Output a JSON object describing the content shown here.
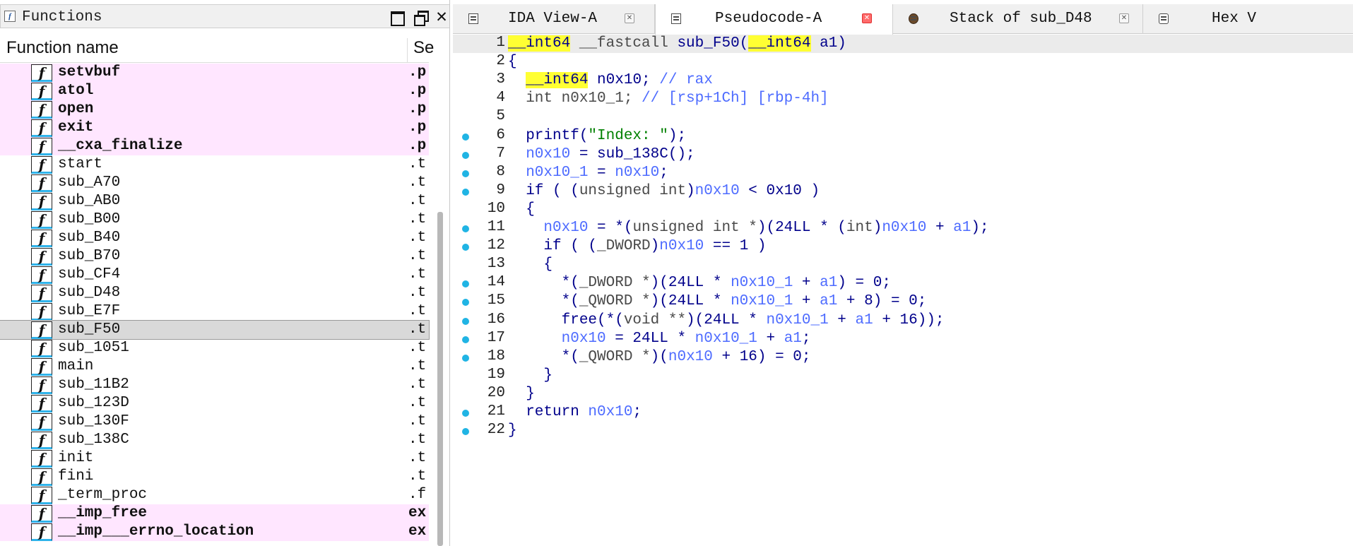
{
  "functions_panel": {
    "title": "Functions",
    "columns": {
      "name": "Function name",
      "segment": "Se"
    },
    "rows": [
      {
        "name": "setvbuf",
        "seg": ".p",
        "kind": "import"
      },
      {
        "name": "atol",
        "seg": ".p",
        "kind": "import"
      },
      {
        "name": "open",
        "seg": ".p",
        "kind": "import"
      },
      {
        "name": "exit",
        "seg": ".p",
        "kind": "import"
      },
      {
        "name": "__cxa_finalize",
        "seg": ".p",
        "kind": "import"
      },
      {
        "name": "start",
        "seg": ".t",
        "kind": "normal"
      },
      {
        "name": "sub_A70",
        "seg": ".t",
        "kind": "normal"
      },
      {
        "name": "sub_AB0",
        "seg": ".t",
        "kind": "normal"
      },
      {
        "name": "sub_B00",
        "seg": ".t",
        "kind": "normal"
      },
      {
        "name": "sub_B40",
        "seg": ".t",
        "kind": "normal"
      },
      {
        "name": "sub_B70",
        "seg": ".t",
        "kind": "normal"
      },
      {
        "name": "sub_CF4",
        "seg": ".t",
        "kind": "normal"
      },
      {
        "name": "sub_D48",
        "seg": ".t",
        "kind": "normal"
      },
      {
        "name": "sub_E7F",
        "seg": ".t",
        "kind": "normal"
      },
      {
        "name": "sub_F50",
        "seg": ".t",
        "kind": "selected"
      },
      {
        "name": "sub_1051",
        "seg": ".t",
        "kind": "normal"
      },
      {
        "name": "main",
        "seg": ".t",
        "kind": "normal"
      },
      {
        "name": "sub_11B2",
        "seg": ".t",
        "kind": "normal"
      },
      {
        "name": "sub_123D",
        "seg": ".t",
        "kind": "normal"
      },
      {
        "name": "sub_130F",
        "seg": ".t",
        "kind": "normal"
      },
      {
        "name": "sub_138C",
        "seg": ".t",
        "kind": "normal"
      },
      {
        "name": "init",
        "seg": ".t",
        "kind": "normal"
      },
      {
        "name": "fini",
        "seg": ".t",
        "kind": "normal"
      },
      {
        "name": "_term_proc",
        "seg": ".f",
        "kind": "normal"
      },
      {
        "name": "__imp_free",
        "seg": "ex",
        "kind": "import"
      },
      {
        "name": "__imp___errno_location",
        "seg": "ex",
        "kind": "import"
      }
    ]
  },
  "tabs": [
    {
      "label": "IDA View-A",
      "active": false
    },
    {
      "label": "Pseudocode-A",
      "active": true
    },
    {
      "label": "Stack of sub_D48",
      "active": false
    },
    {
      "label": "Hex V",
      "active": false
    }
  ],
  "code": {
    "lines": [
      {
        "no": "1",
        "bp": false,
        "hl": true,
        "tokens": [
          [
            "y",
            "__int64"
          ],
          [
            "t",
            " __fastcall "
          ],
          [
            "k",
            "sub_F50("
          ],
          [
            "y",
            "__int64"
          ],
          [
            "k",
            " a1)"
          ]
        ]
      },
      {
        "no": "2",
        "bp": false,
        "hl": false,
        "tokens": [
          [
            "k",
            "{"
          ]
        ]
      },
      {
        "no": "3",
        "bp": false,
        "hl": false,
        "tokens": [
          [
            "k",
            "  "
          ],
          [
            "y",
            "__int64"
          ],
          [
            "k",
            " n0x10; "
          ],
          [
            "c",
            "// rax"
          ]
        ]
      },
      {
        "no": "4",
        "bp": false,
        "hl": false,
        "tokens": [
          [
            "t",
            "  int n0x10_1; "
          ],
          [
            "c",
            "// [rsp+1Ch] [rbp-4h]"
          ]
        ]
      },
      {
        "no": "5",
        "bp": false,
        "hl": false,
        "tokens": []
      },
      {
        "no": "6",
        "bp": true,
        "hl": false,
        "tokens": [
          [
            "k",
            "  printf("
          ],
          [
            "s",
            "\"Index: \""
          ],
          [
            "k",
            ");"
          ]
        ]
      },
      {
        "no": "7",
        "bp": true,
        "hl": false,
        "tokens": [
          [
            "v",
            "  n0x10"
          ],
          [
            "k",
            " = sub_138C();"
          ]
        ]
      },
      {
        "no": "8",
        "bp": true,
        "hl": false,
        "tokens": [
          [
            "v",
            "  n0x10_1"
          ],
          [
            "k",
            " = "
          ],
          [
            "v",
            "n0x10"
          ],
          [
            "k",
            ";"
          ]
        ]
      },
      {
        "no": "9",
        "bp": true,
        "hl": false,
        "tokens": [
          [
            "k",
            "  if ( ("
          ],
          [
            "t",
            "unsigned int"
          ],
          [
            "k",
            ")"
          ],
          [
            "v",
            "n0x10"
          ],
          [
            "k",
            " < 0x10 )"
          ]
        ]
      },
      {
        "no": "10",
        "bp": false,
        "hl": false,
        "tokens": [
          [
            "k",
            "  {"
          ]
        ]
      },
      {
        "no": "11",
        "bp": true,
        "hl": false,
        "tokens": [
          [
            "v",
            "    n0x10"
          ],
          [
            "k",
            " = *("
          ],
          [
            "t",
            "unsigned int *"
          ],
          [
            "k",
            ")(24LL * ("
          ],
          [
            "t",
            "int"
          ],
          [
            "k",
            ")"
          ],
          [
            "v",
            "n0x10"
          ],
          [
            "k",
            " + "
          ],
          [
            "v",
            "a1"
          ],
          [
            "k",
            ");"
          ]
        ]
      },
      {
        "no": "12",
        "bp": true,
        "hl": false,
        "tokens": [
          [
            "k",
            "    if ( ("
          ],
          [
            "t",
            "_DWORD"
          ],
          [
            "k",
            ")"
          ],
          [
            "v",
            "n0x10"
          ],
          [
            "k",
            " == 1 )"
          ]
        ]
      },
      {
        "no": "13",
        "bp": false,
        "hl": false,
        "tokens": [
          [
            "k",
            "    {"
          ]
        ]
      },
      {
        "no": "14",
        "bp": true,
        "hl": false,
        "tokens": [
          [
            "k",
            "      *("
          ],
          [
            "t",
            "_DWORD *"
          ],
          [
            "k",
            ")(24LL * "
          ],
          [
            "v",
            "n0x10_1"
          ],
          [
            "k",
            " + "
          ],
          [
            "v",
            "a1"
          ],
          [
            "k",
            ") = 0;"
          ]
        ]
      },
      {
        "no": "15",
        "bp": true,
        "hl": false,
        "tokens": [
          [
            "k",
            "      *("
          ],
          [
            "t",
            "_QWORD *"
          ],
          [
            "k",
            ")(24LL * "
          ],
          [
            "v",
            "n0x10_1"
          ],
          [
            "k",
            " + "
          ],
          [
            "v",
            "a1"
          ],
          [
            "k",
            " + 8) = 0;"
          ]
        ]
      },
      {
        "no": "16",
        "bp": true,
        "hl": false,
        "tokens": [
          [
            "k",
            "      free(*("
          ],
          [
            "t",
            "void **"
          ],
          [
            "k",
            ")(24LL * "
          ],
          [
            "v",
            "n0x10_1"
          ],
          [
            "k",
            " + "
          ],
          [
            "v",
            "a1"
          ],
          [
            "k",
            " + 16));"
          ]
        ]
      },
      {
        "no": "17",
        "bp": true,
        "hl": false,
        "tokens": [
          [
            "v",
            "      n0x10"
          ],
          [
            "k",
            " = 24LL * "
          ],
          [
            "v",
            "n0x10_1"
          ],
          [
            "k",
            " + "
          ],
          [
            "v",
            "a1"
          ],
          [
            "k",
            ";"
          ]
        ]
      },
      {
        "no": "18",
        "bp": true,
        "hl": false,
        "tokens": [
          [
            "k",
            "      *("
          ],
          [
            "t",
            "_QWORD *"
          ],
          [
            "k",
            ")("
          ],
          [
            "v",
            "n0x10"
          ],
          [
            "k",
            " + 16) = 0;"
          ]
        ]
      },
      {
        "no": "19",
        "bp": false,
        "hl": false,
        "tokens": [
          [
            "k",
            "    }"
          ]
        ]
      },
      {
        "no": "20",
        "bp": false,
        "hl": false,
        "tokens": [
          [
            "k",
            "  }"
          ]
        ]
      },
      {
        "no": "21",
        "bp": true,
        "hl": false,
        "tokens": [
          [
            "k",
            "  return "
          ],
          [
            "v",
            "n0x10"
          ],
          [
            "k",
            ";"
          ]
        ]
      },
      {
        "no": "22",
        "bp": true,
        "hl": false,
        "tokens": [
          [
            "k",
            "}"
          ]
        ]
      }
    ]
  }
}
